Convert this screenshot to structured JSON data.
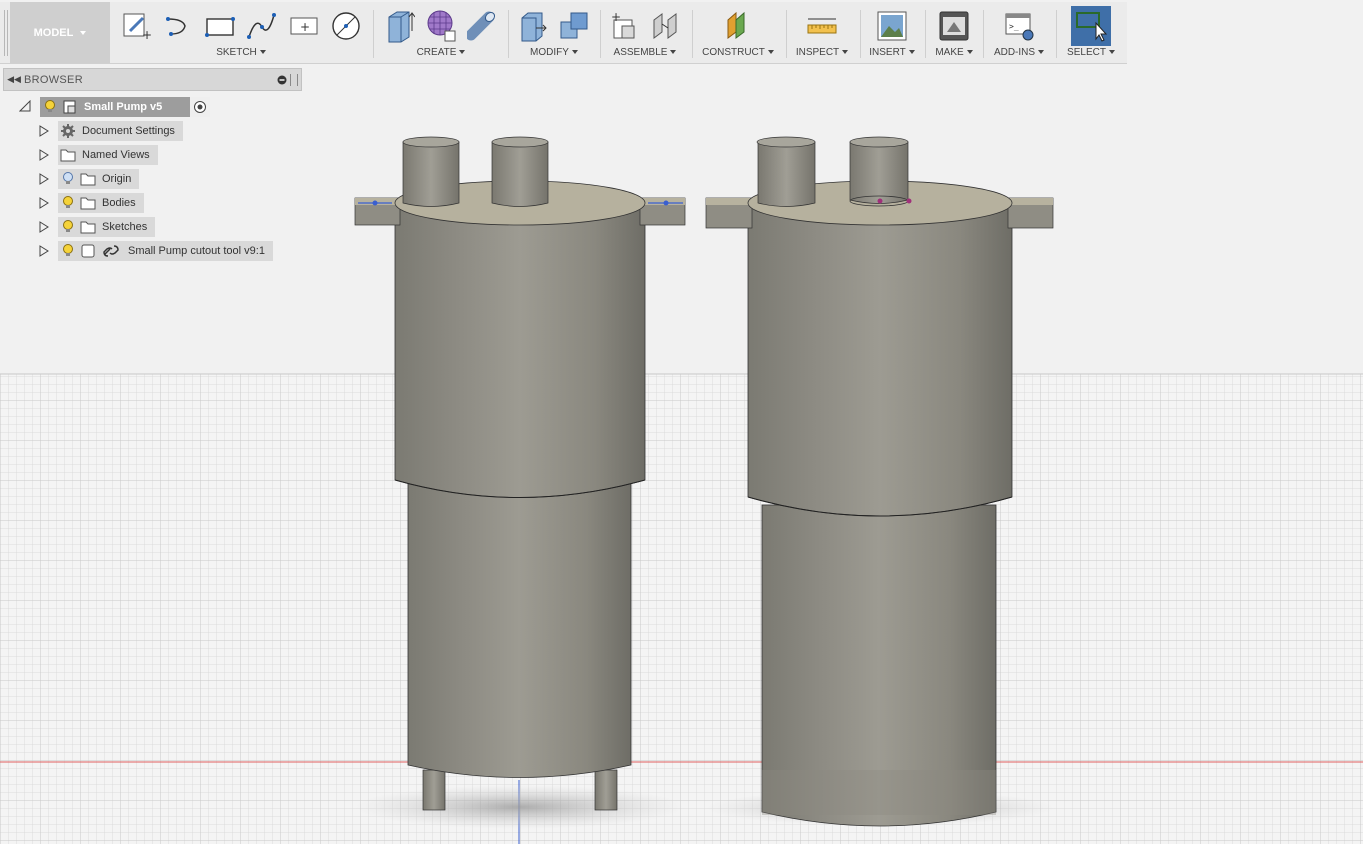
{
  "toolbar": {
    "workspace": "MODEL",
    "groups": {
      "sketch": "SKETCH",
      "create": "CREATE",
      "modify": "MODIFY",
      "assemble": "ASSEMBLE",
      "construct": "CONSTRUCT",
      "inspect": "INSPECT",
      "insert": "INSERT",
      "make": "MAKE",
      "addins": "ADD-INS",
      "select": "SELECT"
    }
  },
  "browser": {
    "title": "BROWSER",
    "root": "Small Pump v5",
    "items": [
      {
        "label": "Document Settings",
        "icon": "gear-icon"
      },
      {
        "label": "Named Views",
        "icon": "folder-icon"
      },
      {
        "label": "Origin",
        "icon": "folder-icon",
        "visibility": "off"
      },
      {
        "label": "Bodies",
        "icon": "folder-icon",
        "visibility": "on"
      },
      {
        "label": "Sketches",
        "icon": "folder-icon",
        "visibility": "on"
      },
      {
        "label": "Small Pump cutout tool v9:1",
        "icon": "component-link-icon",
        "visibility": "on"
      }
    ]
  },
  "colors": {
    "toolbar_bg": "#ebebeb",
    "select_active": "#3f6fa8",
    "body_gray": "#8e8c83",
    "grid_line": "#d0d0d0",
    "axis_red": "#e06060",
    "axis_blue": "#3a5fd0"
  }
}
